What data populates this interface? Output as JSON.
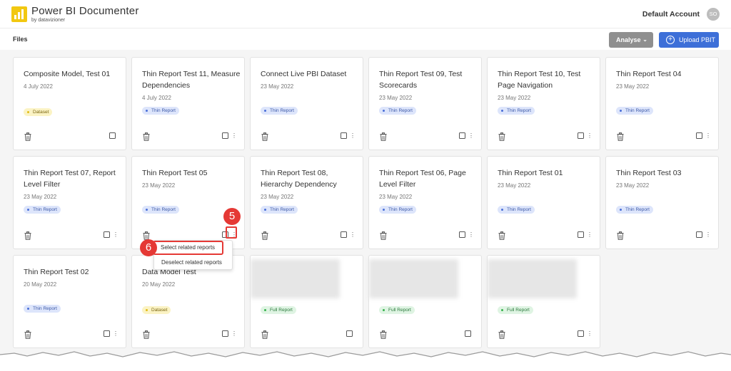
{
  "header": {
    "app_title": "Power BI Documenter",
    "app_subtitle": "by datavizioner",
    "account_name": "Default Account",
    "avatar_initials": "SO"
  },
  "toolbar": {
    "files_label": "Files",
    "analyse_label": "Analyse",
    "upload_label": "Upload PBIT"
  },
  "colors": {
    "primary": "#3d6fd8",
    "analyse": "#8f8f8f",
    "highlight": "#e53935",
    "logo": "#f2c811"
  },
  "cards": [
    {
      "title": "Composite Model, Test 01",
      "date": "4 July 2022",
      "badge": "Dataset",
      "badge_type": "dataset",
      "kebab": false
    },
    {
      "title": "Thin Report Test 11, Measure Dependencies",
      "date": "4 July 2022",
      "badge": "Thin Report",
      "badge_type": "thin",
      "kebab": true
    },
    {
      "title": "Connect Live PBI Dataset",
      "date": "23 May 2022",
      "badge": "Thin Report",
      "badge_type": "thin",
      "kebab": true
    },
    {
      "title": "Thin Report Test 09, Test Scorecards",
      "date": "23 May 2022",
      "badge": "Thin Report",
      "badge_type": "thin",
      "kebab": true
    },
    {
      "title": "Thin Report Test 10, Test Page Navigation",
      "date": "23 May 2022",
      "badge": "Thin Report",
      "badge_type": "thin",
      "kebab": true
    },
    {
      "title": "Thin Report Test 04",
      "date": "23 May 2022",
      "badge": "Thin Report",
      "badge_type": "thin",
      "kebab": true
    },
    {
      "title": "Thin Report Test 07, Report Level Filter",
      "date": "23 May 2022",
      "badge": "Thin Report",
      "badge_type": "thin",
      "kebab": true
    },
    {
      "title": "Thin Report Test 05",
      "date": "23 May 2022",
      "badge": "Thin Report",
      "badge_type": "thin",
      "kebab": true
    },
    {
      "title": "Thin Report Test 08, Hierarchy Dependency",
      "date": "23 May 2022",
      "badge": "Thin Report",
      "badge_type": "thin",
      "kebab": true
    },
    {
      "title": "Thin Report Test 06, Page Level Filter",
      "date": "23 May 2022",
      "badge": "Thin Report",
      "badge_type": "thin",
      "kebab": true
    },
    {
      "title": "Thin Report Test 01",
      "date": "23 May 2022",
      "badge": "Thin Report",
      "badge_type": "thin",
      "kebab": true
    },
    {
      "title": "Thin Report Test 03",
      "date": "23 May 2022",
      "badge": "Thin Report",
      "badge_type": "thin",
      "kebab": true
    },
    {
      "title": "Thin Report Test 02",
      "date": "20 May 2022",
      "badge": "Thin Report",
      "badge_type": "thin",
      "kebab": true
    },
    {
      "title": "Data Model Test",
      "date": "20 May 2022",
      "badge": "Dataset",
      "badge_type": "dataset",
      "kebab": true
    },
    {
      "title": "",
      "date": "",
      "badge": "Full Report",
      "badge_type": "full",
      "kebab": false,
      "blurred": true
    },
    {
      "title": "",
      "date": "",
      "badge": "Full Report",
      "badge_type": "full",
      "kebab": false,
      "blurred": true
    },
    {
      "title": "",
      "date": "",
      "badge": "Full Report",
      "badge_type": "full",
      "kebab": true,
      "blurred": true
    }
  ],
  "context_menu": {
    "items": [
      "Select related reports",
      "Deselect related reports"
    ]
  },
  "annotations": {
    "step_kebab": "5",
    "step_menu": "6"
  }
}
